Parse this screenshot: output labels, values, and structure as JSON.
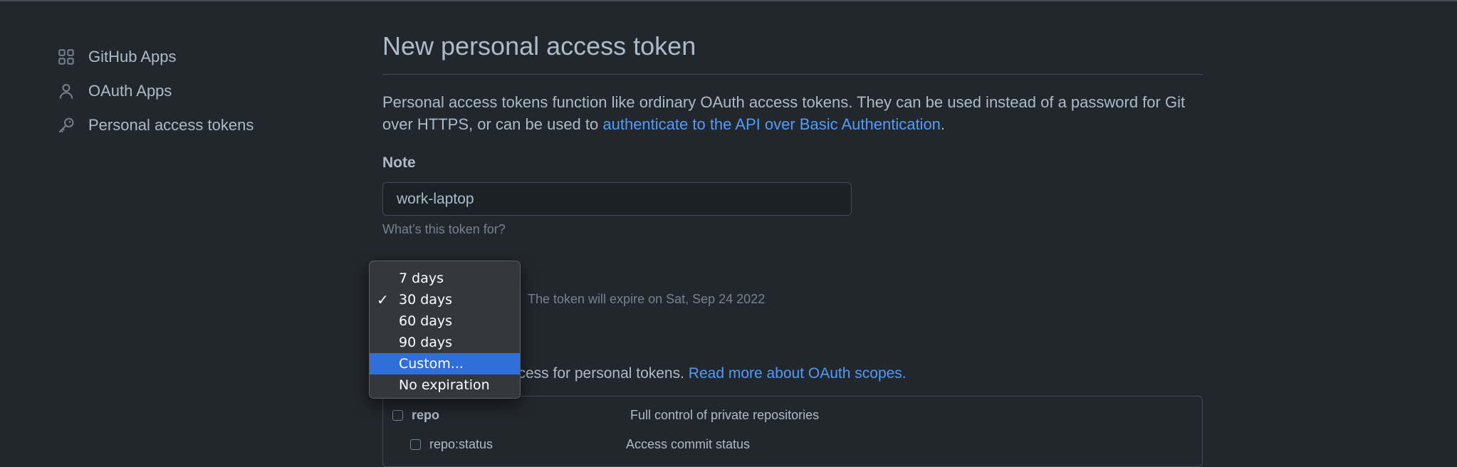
{
  "sidebar": {
    "items": [
      {
        "label": "GitHub Apps",
        "icon": "apps-grid-icon"
      },
      {
        "label": "OAuth Apps",
        "icon": "person-icon"
      },
      {
        "label": "Personal access tokens",
        "icon": "key-icon"
      }
    ]
  },
  "main": {
    "title": "New personal access token",
    "intro_text": "Personal access tokens function like ordinary OAuth access tokens. They can be used instead of a password for Git over HTTPS, or can be used to ",
    "intro_link": "authenticate to the API over Basic Authentication",
    "intro_end": ".",
    "note": {
      "label": "Note",
      "value": "work-laptop",
      "help": "What’s this token for?"
    },
    "expiration": {
      "note": "The token will expire on Sat, Sep 24 2022"
    },
    "scopes": {
      "text_visible": "ccess for personal tokens. ",
      "link": "Read more about OAuth scopes.",
      "rows": [
        {
          "name": "repo",
          "desc": "Full control of private repositories",
          "checked": false
        },
        {
          "name": "repo:status",
          "desc": "Access commit status",
          "checked": false
        }
      ]
    }
  },
  "dropdown": {
    "options": [
      "7 days",
      "30 days",
      "60 days",
      "90 days",
      "Custom...",
      "No expiration"
    ],
    "selected": "30 days",
    "highlighted": "Custom...",
    "check_glyph": "✓"
  },
  "colors": {
    "background": "#22272e",
    "text": "#adbac7",
    "muted": "#768390",
    "link": "#539bf5",
    "highlight": "#2f6fd9"
  }
}
